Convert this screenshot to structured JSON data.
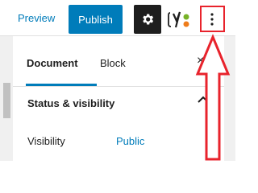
{
  "toolbar": {
    "preview_label": "Preview",
    "publish_label": "Publish",
    "settings_icon": "gear-icon",
    "yoast_icon": "yoast-seo-icon",
    "more_icon": "vertical-ellipsis-icon",
    "more_label": "⋮"
  },
  "sidebar": {
    "tabs": [
      {
        "label": "Document",
        "active": true
      },
      {
        "label": "Block",
        "active": false
      }
    ],
    "close_label": "×",
    "panel": {
      "title": "Status & visibility",
      "expanded": true,
      "rows": [
        {
          "label": "Visibility",
          "value": "Public"
        }
      ]
    }
  },
  "colors": {
    "accent": "#007cba",
    "dark": "#1e1e1e",
    "annotation": "#e8232c"
  }
}
